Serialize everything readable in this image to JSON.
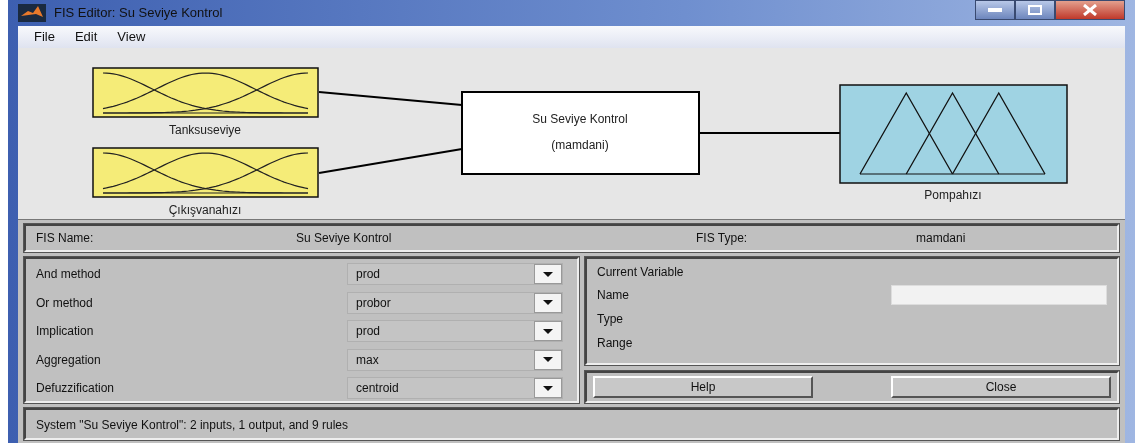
{
  "window": {
    "title": "FIS Editor: Su Seviye Kontrol"
  },
  "menu": [
    "File",
    "Edit",
    "View"
  ],
  "diagram": {
    "inputs": [
      {
        "name": "Tanksuseviye",
        "kind": "gaussian"
      },
      {
        "name": "Çıkışvanahızı",
        "kind": "gaussian"
      }
    ],
    "system": {
      "name": "Su Seviye Kontrol",
      "type": "(mamdani)"
    },
    "outputs": [
      {
        "name": "Pompahızı",
        "kind": "triangular"
      }
    ]
  },
  "fis_name": {
    "label": "FIS Name:",
    "value": "Su Seviye Kontrol"
  },
  "fis_type": {
    "label": "FIS Type:",
    "value": "mamdani"
  },
  "methods": [
    {
      "label": "And method",
      "value": "prod"
    },
    {
      "label": "Or method",
      "value": "probor"
    },
    {
      "label": "Implication",
      "value": "prod"
    },
    {
      "label": "Aggregation",
      "value": "max"
    },
    {
      "label": "Defuzzification",
      "value": "centroid"
    }
  ],
  "current_variable": {
    "title": "Current Variable",
    "fields": [
      {
        "label": "Name",
        "kind": "input"
      },
      {
        "label": "Type",
        "kind": "text"
      },
      {
        "label": "Range",
        "kind": "text"
      }
    ]
  },
  "buttons": [
    "Help",
    "Close"
  ],
  "status": "System \"Su Seviye Kontrol\": 2 inputs, 1 output, and 9 rules"
}
